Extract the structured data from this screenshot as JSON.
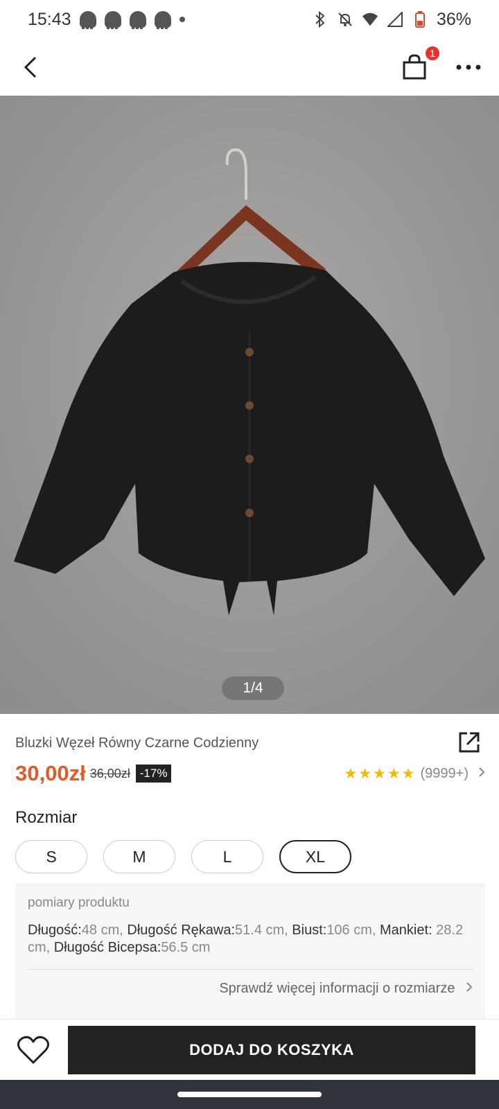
{
  "status_bar": {
    "time": "15:43",
    "battery": "36%"
  },
  "header": {
    "cart_count": "1"
  },
  "gallery": {
    "counter": "1/4"
  },
  "product": {
    "title": "Bluzki Węzeł Równy Czarne Codzienny",
    "price": "30,00zł",
    "original_price": "36,00zł",
    "discount": "-17%",
    "rating_stars": 4.5,
    "rating_count": "(9999+)"
  },
  "size": {
    "label": "Rozmiar",
    "options": [
      "S",
      "M",
      "L",
      "XL"
    ],
    "selected": "XL"
  },
  "measurements": {
    "title": "pomiary produktu",
    "items": [
      {
        "label": "Długość:",
        "value": "48 cm, "
      },
      {
        "label": "Długość Rękawa:",
        "value": "51.4 cm, "
      },
      {
        "label": "Biust:",
        "value": "106 cm, "
      },
      {
        "label": "Mankiet:",
        "value": " 28.2 cm, "
      },
      {
        "label": "Długość Bicepsa:",
        "value": "56.5 cm"
      }
    ],
    "more_link": "Sprawdź więcej informacji o rozmiarze"
  },
  "actions": {
    "add_to_cart": "DODAJ DO KOSZYKA"
  },
  "colors": {
    "price": "#e05a2b",
    "star": "#f5b800",
    "badge": "#e8322f",
    "button": "#222222"
  }
}
